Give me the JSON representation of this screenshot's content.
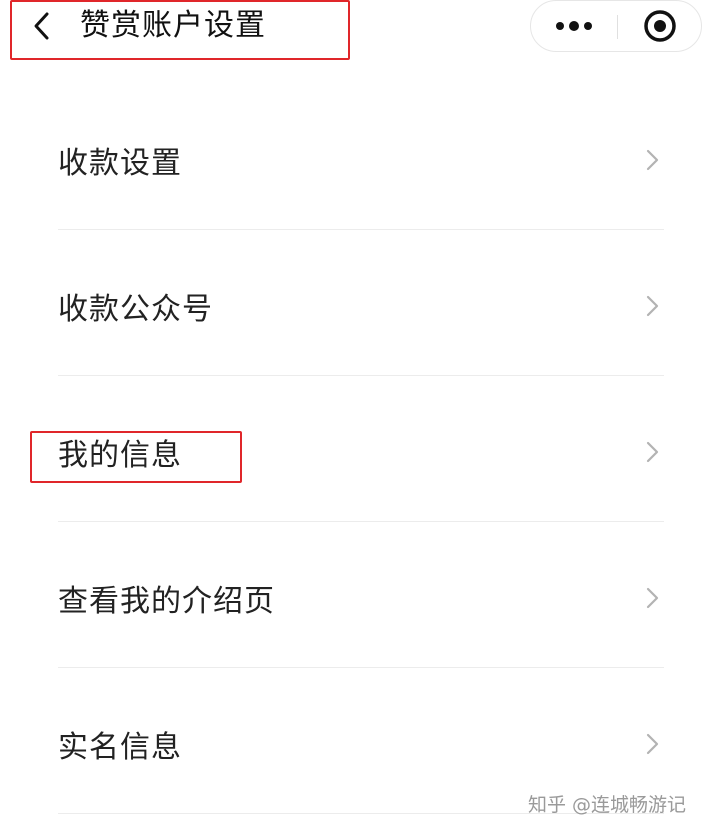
{
  "nav": {
    "title": "赞赏账户设置",
    "back_icon": "chevron-left-icon",
    "more_icon": "more-dots-icon",
    "close_icon": "target-circle-icon"
  },
  "menu": {
    "items": [
      {
        "label": "收款设置"
      },
      {
        "label": "收款公众号"
      },
      {
        "label": "我的信息"
      },
      {
        "label": "查看我的介绍页"
      },
      {
        "label": "实名信息"
      }
    ],
    "chevron_icon": "chevron-right-icon"
  },
  "watermark": {
    "text": "知乎 @连城畅游记"
  },
  "colors": {
    "highlight": "#e0262a",
    "text": "#222222",
    "chevron": "#b3b3b3",
    "divider": "#ececec",
    "watermark": "#9a9a9a"
  }
}
